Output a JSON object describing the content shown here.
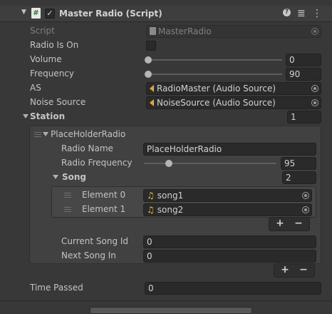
{
  "header": {
    "title": "Master Radio (Script)",
    "enabled_check": "✓",
    "script_glyph": "#",
    "help_glyph": "?",
    "presets_glyph": "≣",
    "menu_glyph": "⋮",
    "collapse_glyph": "▼"
  },
  "fields": {
    "script": {
      "label": "Script",
      "value": "MasterRadio"
    },
    "radio_is_on": {
      "label": "Radio Is On",
      "checked": false
    },
    "volume": {
      "label": "Volume",
      "value": "0",
      "slider_fraction": 0.0
    },
    "frequency": {
      "label": "Frequency",
      "value": "90",
      "slider_fraction": 0.0
    },
    "as": {
      "label": "AS",
      "value": "RadioMaster (Audio Source)"
    },
    "noise_source": {
      "label": "Noise Source",
      "value": "NoiseSource (Audio Source)"
    },
    "station": {
      "label": "Station",
      "count": "1"
    },
    "time_passed": {
      "label": "Time Passed",
      "value": "0"
    }
  },
  "station_element": {
    "title": "PlaceHolderRadio",
    "radio_name": {
      "label": "Radio Name",
      "value": "PlaceHolderRadio"
    },
    "radio_frequency": {
      "label": "Radio Frequency",
      "value": "95",
      "slider_fraction": 0.2
    },
    "song": {
      "label": "Song",
      "count": "2",
      "elements": [
        {
          "label": "Element 0",
          "value": "song1"
        },
        {
          "label": "Element 1",
          "value": "song2"
        }
      ]
    },
    "current_song_id": {
      "label": "Current Song Id",
      "value": "0"
    },
    "next_song_in": {
      "label": "Next Song In",
      "value": "0"
    }
  },
  "buttons": {
    "plus": "+",
    "minus": "−"
  },
  "colors": {
    "accent_audio": "#e0a63c",
    "accent_note": "#e3c640",
    "background": "#383838"
  }
}
